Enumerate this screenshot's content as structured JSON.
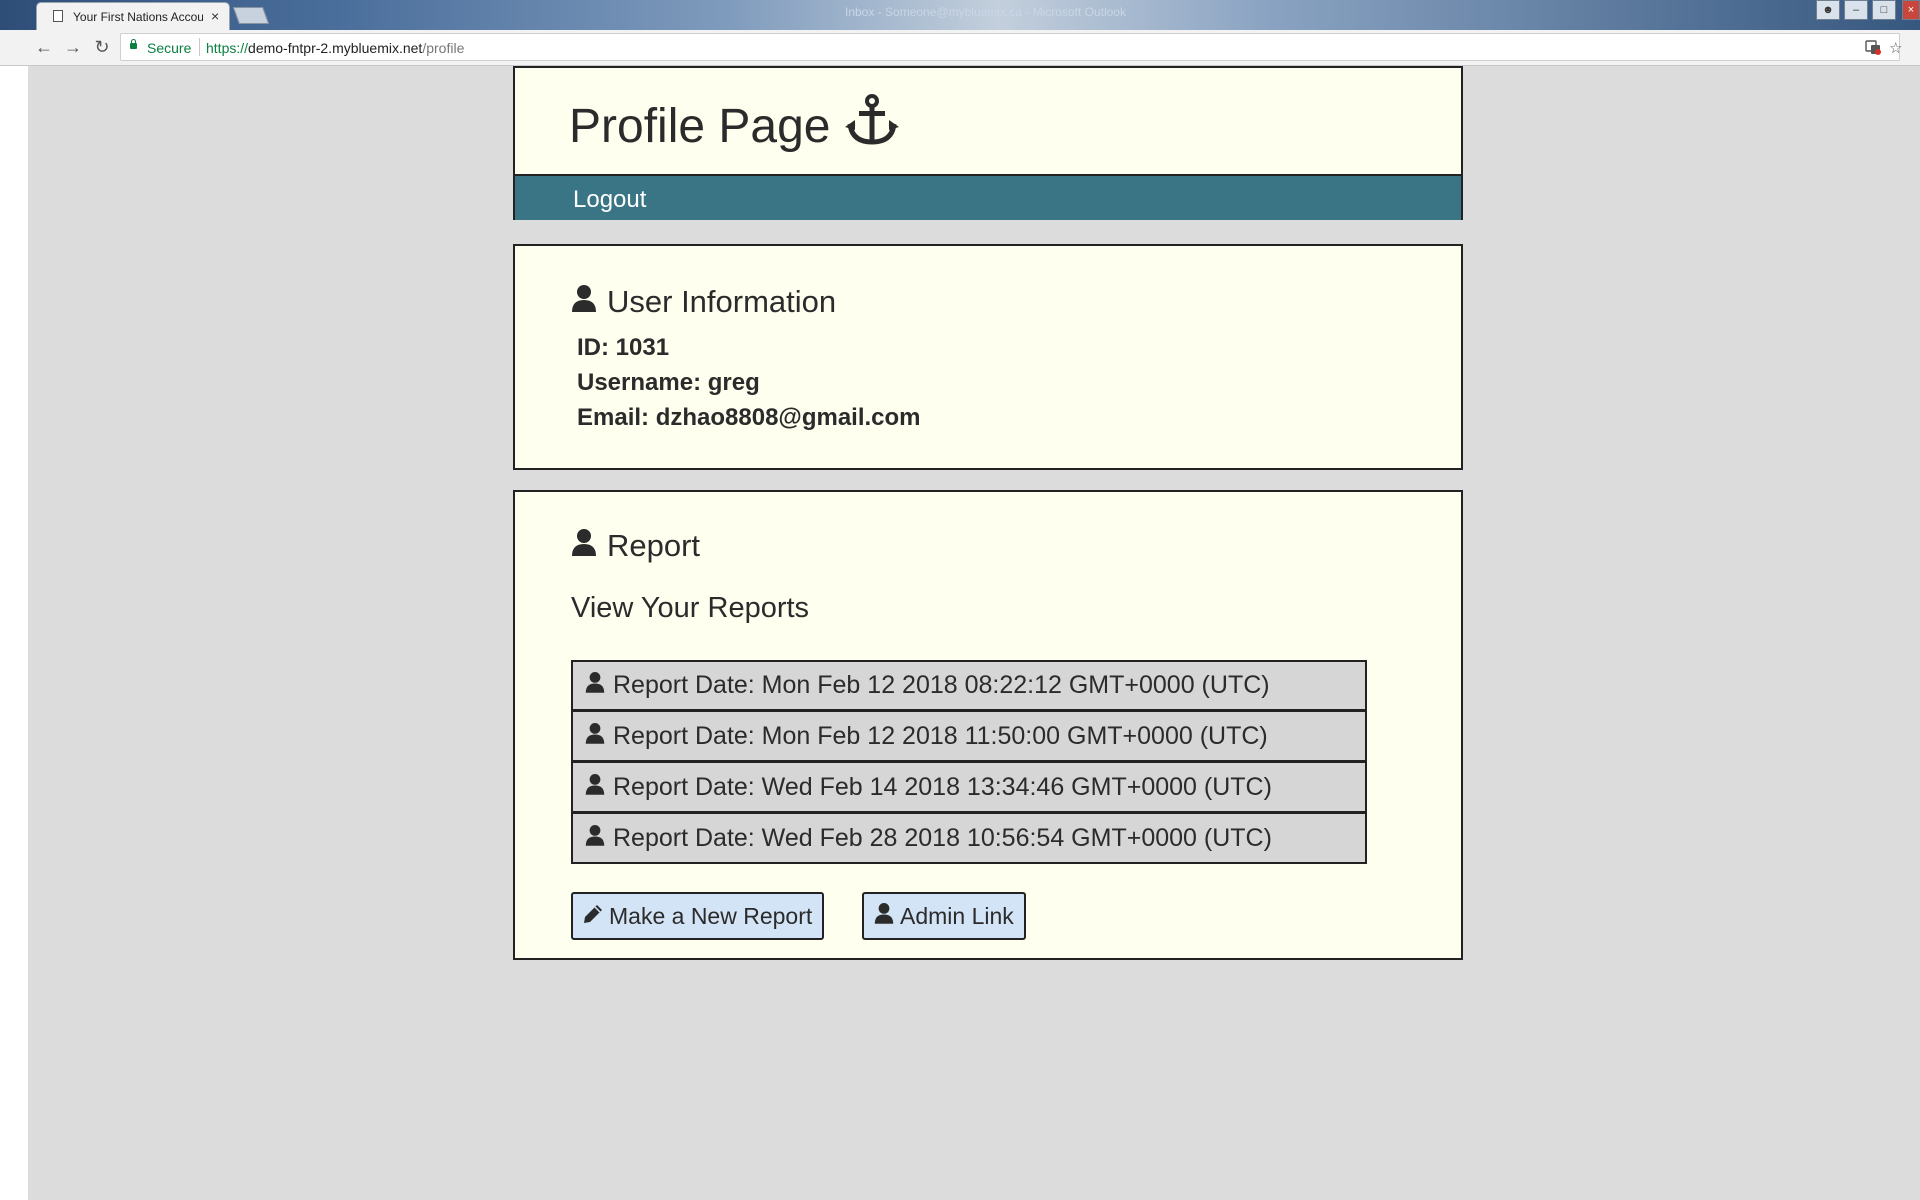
{
  "browser": {
    "tab_title": "Your First Nations Accou",
    "tab_close": "×",
    "window_title": "Inbox - Someone@mybluemix.ca - Microsoft Outlook",
    "back_icon": "←",
    "forward_icon": "→",
    "reload_icon": "↻",
    "secure_label": "Secure",
    "url_scheme": "https://",
    "url_host": "demo-fntpr-2.mybluemix.net",
    "url_path": "/profile",
    "star_icon": "☆"
  },
  "header": {
    "title": "Profile Page",
    "title_icon": "anchor-icon",
    "nav": {
      "logout_label": "Logout"
    }
  },
  "user_info": {
    "heading": "User Information",
    "heading_icon": "user-icon",
    "id_line": "ID: 1031",
    "username_line": "Username: greg",
    "email_line": "Email: dzhao8808@gmail.com"
  },
  "report": {
    "heading": "Report",
    "heading_icon": "user-icon",
    "subheading": "View Your Reports",
    "items": [
      {
        "label": "Report Date: Mon Feb 12 2018 08:22:12 GMT+0000 (UTC)"
      },
      {
        "label": "Report Date: Mon Feb 12 2018 11:50:00 GMT+0000 (UTC)"
      },
      {
        "label": "Report Date: Wed Feb 14 2018 13:34:46 GMT+0000 (UTC)"
      },
      {
        "label": "Report Date: Wed Feb 28 2018 10:56:54 GMT+0000 (UTC)"
      }
    ],
    "new_report_label": "Make a New Report",
    "new_report_icon": "pencil-icon",
    "admin_label": "Admin Link",
    "admin_icon": "user-icon"
  },
  "colors": {
    "page_bg": "#dcdcdc",
    "card_bg": "#fffff0",
    "nav_bg": "#3a7585",
    "report_item_bg": "#d6d6d6",
    "button_bg": "#d4e4f7"
  }
}
